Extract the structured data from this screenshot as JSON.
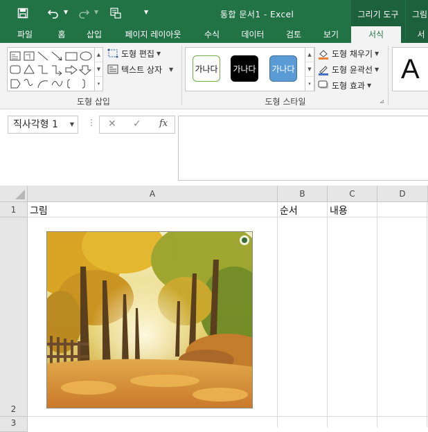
{
  "title_bar": {
    "document_title": "통합 문서1 - Excel",
    "context_groups": [
      "그리기 도구",
      "그림"
    ],
    "qat_icons": [
      "save-icon",
      "undo-icon",
      "redo-icon",
      "customize-icon"
    ]
  },
  "tabs": [
    {
      "label": "파일",
      "active": false
    },
    {
      "label": "홈",
      "active": false
    },
    {
      "label": "삽입",
      "active": false
    },
    {
      "label": "페이지 레이아웃",
      "active": false
    },
    {
      "label": "수식",
      "active": false
    },
    {
      "label": "데이터",
      "active": false
    },
    {
      "label": "검토",
      "active": false
    },
    {
      "label": "보기",
      "active": false
    },
    {
      "label": "서식",
      "active": true
    },
    {
      "label": "서",
      "active": false
    }
  ],
  "ribbon": {
    "insert_shapes": {
      "label": "도형 삽입",
      "edit_shape": "도형 편집",
      "text_box": "텍스트 상자"
    },
    "shape_styles": {
      "label": "도형 스타일",
      "presets": [
        "가나다",
        "가나다",
        "가나다"
      ],
      "fill": "도형 채우기",
      "outline": "도형 윤곽선",
      "effects": "도형 효과"
    },
    "wordart_sample": "A"
  },
  "formula_bar": {
    "name_box": "직사각형 1",
    "cancel_symbol": "✕",
    "enter_symbol": "✓",
    "fx_label": "fx",
    "formula": ""
  },
  "sheet": {
    "columns": [
      "A",
      "B",
      "C",
      "D"
    ],
    "rows": [
      "1",
      "2",
      "3"
    ],
    "cells": {
      "A1": "그림",
      "B1": "순서",
      "C1": "내용"
    }
  },
  "colors": {
    "excel_green": "#217346",
    "context_green": "#1c613b",
    "ribbon_bg": "#f3f3f3"
  }
}
